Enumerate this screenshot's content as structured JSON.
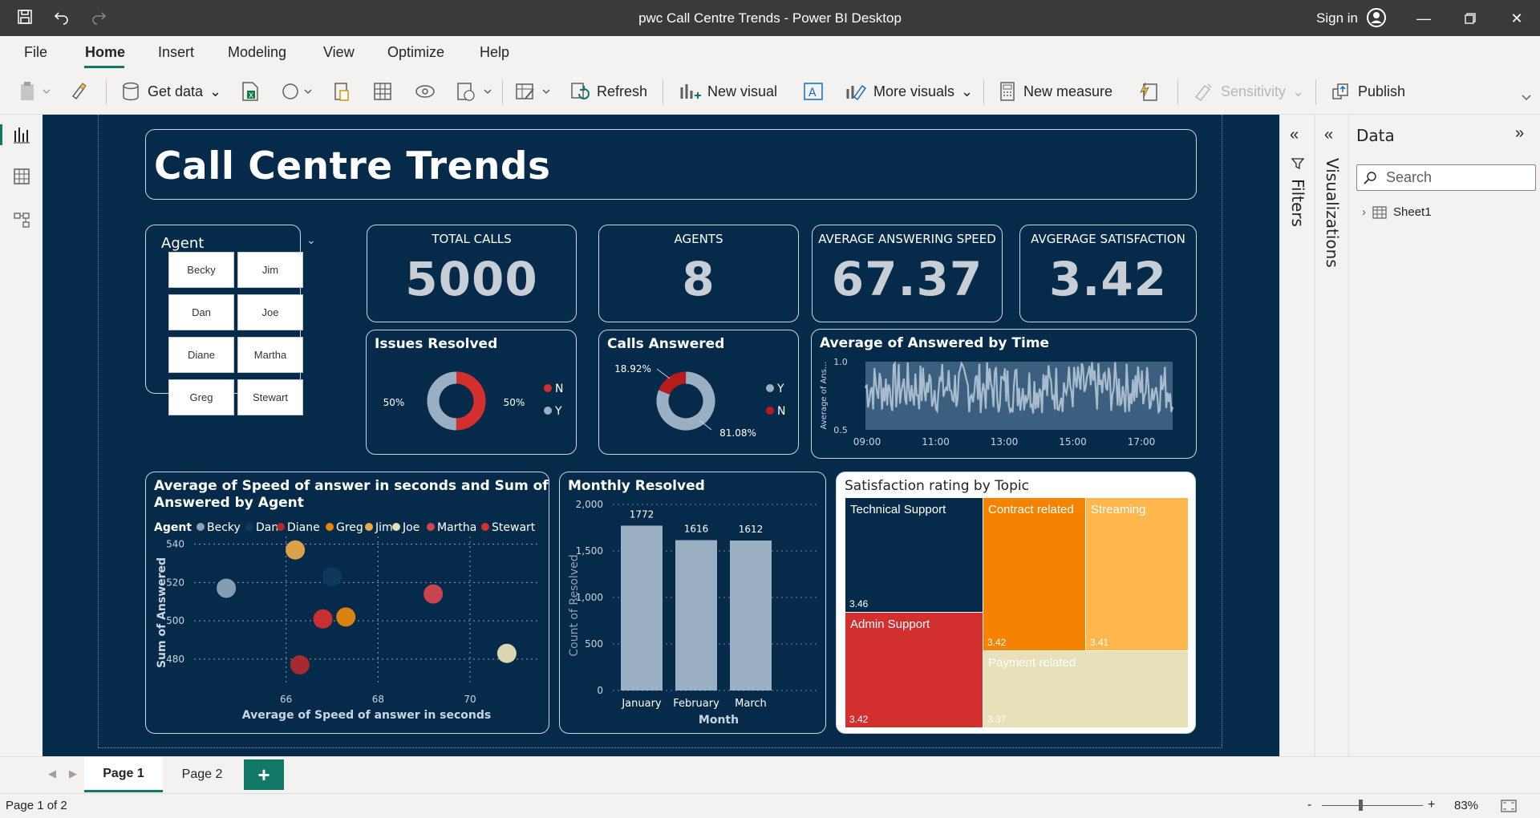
{
  "window": {
    "title": "pwc Call Centre Trends - Power BI Desktop",
    "signin": "Sign in"
  },
  "menu": {
    "file": "File",
    "home": "Home",
    "insert": "Insert",
    "modeling": "Modeling",
    "view": "View",
    "optimize": "Optimize",
    "help": "Help"
  },
  "ribbon": {
    "get_data": "Get data",
    "refresh": "Refresh",
    "new_visual": "New visual",
    "more_visuals": "More visuals",
    "new_measure": "New measure",
    "sensitivity": "Sensitivity",
    "publish": "Publish"
  },
  "report": {
    "title": "Call Centre Trends",
    "slicer": {
      "title": "Agent",
      "agents": [
        "Becky",
        "Jim",
        "Dan",
        "Joe",
        "Diane",
        "Martha",
        "Greg",
        "Stewart"
      ]
    },
    "kpis": [
      {
        "label": "TOTAL CALLS",
        "value": "5000"
      },
      {
        "label": "AGENTS",
        "value": "8"
      },
      {
        "label": "AVERAGE ANSWERING SPEED",
        "value": "67.37"
      },
      {
        "label": "AVGERAGE SATISFACTION",
        "value": "3.42"
      }
    ],
    "issues_title": "Issues Resolved",
    "calls_title": "Calls Answered",
    "answered_time_title": "Average of Answered by Time",
    "scatter_title_1": "Average of Speed of answer in seconds and Sum of",
    "scatter_title_2": "Answered by Agent",
    "scatter_legend_label": "Agent",
    "monthly_title": "Monthly Resolved",
    "treemap_title": "Satisfaction rating by Topic"
  },
  "colors": {
    "bg": "#062b4a",
    "red": "#d32f2f",
    "grey": "#9bafc2",
    "orange": "#f58200",
    "light_orange": "#ffb74d",
    "cream": "#e8e0b8",
    "navy": "#062b4a"
  },
  "chart_data": [
    {
      "type": "pie",
      "title": "Issues Resolved",
      "categories": [
        "N",
        "Y"
      ],
      "values": [
        50,
        50
      ],
      "labels": [
        "50%",
        "50%"
      ],
      "colors": [
        "#d32f2f",
        "#9bafc2"
      ]
    },
    {
      "type": "pie",
      "title": "Calls Answered",
      "categories": [
        "Y",
        "N"
      ],
      "values": [
        81.08,
        18.92
      ],
      "labels": [
        "81.08%",
        "18.92%"
      ],
      "colors": [
        "#9bafc2",
        "#b71c1c"
      ]
    },
    {
      "type": "area",
      "title": "Average of Answered by Time",
      "ylabel": "Average of Ans...",
      "ylim": [
        0.5,
        1.0
      ],
      "x_ticks": [
        "09:00",
        "11:00",
        "13:00",
        "15:00",
        "17:00"
      ],
      "y_ticks": [
        "0.5",
        "1.0"
      ]
    },
    {
      "type": "scatter",
      "title": "Average of Speed of answer in seconds and Sum of Answered by Agent",
      "xlabel": "Average of Speed of answer in seconds",
      "ylabel": "Sum of Answered",
      "xlim": [
        64,
        71.5
      ],
      "ylim": [
        472,
        544
      ],
      "x_ticks": [
        66,
        68,
        70
      ],
      "y_ticks": [
        480,
        500,
        520,
        540
      ],
      "series": [
        {
          "name": "Becky",
          "x": 64.7,
          "y": 517,
          "color": "#8ba3b8"
        },
        {
          "name": "Dan",
          "x": 67.0,
          "y": 523,
          "color": "#0e3a60"
        },
        {
          "name": "Diane",
          "x": 66.3,
          "y": 477,
          "color": "#b02a30"
        },
        {
          "name": "Greg",
          "x": 67.3,
          "y": 502,
          "color": "#e6860e"
        },
        {
          "name": "Jim",
          "x": 66.2,
          "y": 537,
          "color": "#e8a94a"
        },
        {
          "name": "Joe",
          "x": 70.8,
          "y": 483,
          "color": "#e6dfb4"
        },
        {
          "name": "Martha",
          "x": 69.2,
          "y": 514,
          "color": "#d2474f"
        },
        {
          "name": "Stewart",
          "x": 66.8,
          "y": 501,
          "color": "#d32f2f"
        }
      ]
    },
    {
      "type": "bar",
      "title": "Monthly Resolved",
      "categories": [
        "January",
        "February",
        "March"
      ],
      "values": [
        1772,
        1616,
        1612
      ],
      "xlabel": "Month",
      "ylabel": "Count of Resolved",
      "ylim": [
        0,
        2000
      ],
      "y_ticks": [
        "0",
        "500",
        "1,000",
        "1,500",
        "2,000"
      ]
    },
    {
      "type": "heatmap",
      "title": "Satisfaction rating by Topic",
      "categories": [
        "Technical Support",
        "Admin Support",
        "Contract related",
        "Streaming",
        "Payment related"
      ],
      "values": [
        3.46,
        3.42,
        3.42,
        3.41,
        3.37
      ]
    }
  ],
  "panes": {
    "filters": "Filters",
    "visualizations": "Visualizations",
    "data": "Data",
    "search_placeholder": "Search",
    "table": "Sheet1"
  },
  "pages": {
    "p1": "Page 1",
    "p2": "Page 2",
    "status": "Page 1 of 2",
    "zoom": "83%"
  }
}
